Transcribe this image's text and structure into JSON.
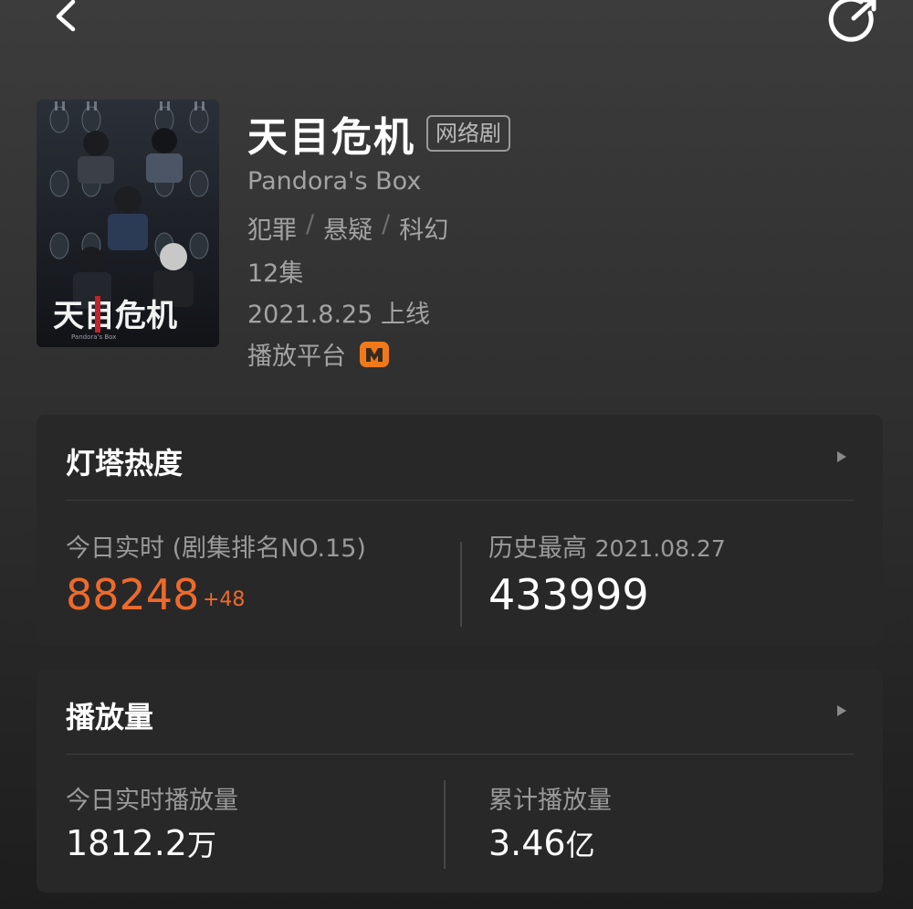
{
  "nav": {
    "back_icon": "chevron-left-icon",
    "share_icon": "share-icon"
  },
  "show": {
    "title": "天目危机",
    "type_tag": "网络剧",
    "english_name": "Pandora's Box",
    "genres": [
      "犯罪",
      "悬疑",
      "科幻"
    ],
    "genre_separator": "/",
    "episodes": "12集",
    "release": "2021.8.25 上线",
    "platform_label": "播放平台",
    "platform_icon": "mango-tv-logo-icon",
    "poster": {
      "title_art": "天目危机",
      "subtitle_art": "Pandora's Box"
    }
  },
  "heat_card": {
    "title": "灯塔热度",
    "arrow_icon": "arrow-right-icon",
    "today_label": "今日实时 (剧集排名NO.15)",
    "today_value": "88248",
    "today_delta": "+48",
    "history_label": "历史最高",
    "history_date": "2021.08.27",
    "history_value": "433999"
  },
  "play_card": {
    "title": "播放量",
    "arrow_icon": "arrow-right-icon",
    "today_label": "今日实时播放量",
    "today_value": "1812.2",
    "today_unit": "万",
    "total_label": "累计播放量",
    "total_value": "3.46",
    "total_unit": "亿"
  },
  "colors": {
    "accent_orange": "#ee6a2b",
    "card_bg": "#282828",
    "secondary_text": "#a3a3a3"
  }
}
